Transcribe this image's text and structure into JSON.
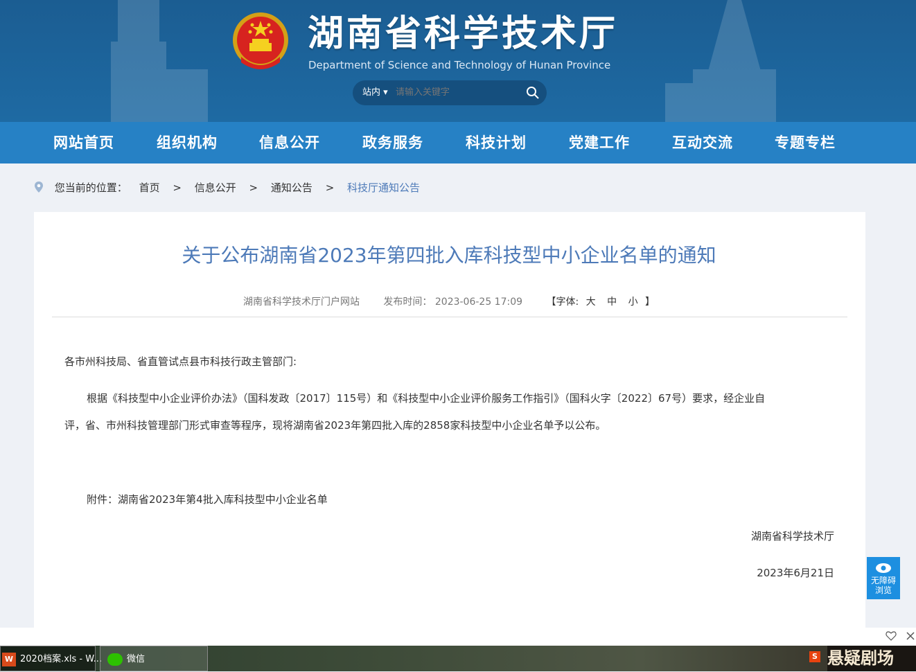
{
  "header": {
    "title": "湖南省科学技术厅",
    "subtitle": "Department of Science and Technology of Hunan Province",
    "search": {
      "scope": "站内",
      "placeholder": "请输入关键字"
    }
  },
  "nav": [
    "网站首页",
    "组织机构",
    "信息公开",
    "政务服务",
    "科技计划",
    "党建工作",
    "互动交流",
    "专题专栏"
  ],
  "breadcrumb": {
    "prefix": "您当前的位置：",
    "items": [
      "首页",
      "信息公开",
      "通知公告",
      "科技厅通知公告"
    ],
    "separator": ">"
  },
  "article": {
    "title": "关于公布湖南省2023年第四批入库科技型中小企业名单的通知",
    "source": "湖南省科学技术厅门户网站",
    "publish_label": "发布时间：",
    "publish_time": "2023-06-25 17:09",
    "font_label": "【字体:",
    "font_sizes": [
      "大",
      "中",
      "小"
    ],
    "font_end": "】",
    "salutation": "各市州科技局、省直管试点县市科技行政主管部门:",
    "body_line1": "根据《科技型中小企业评价办法》（国科发政〔2017〕115号）和《科技型中小企业评价服务工作指引》（国科火字〔2022〕67号）要求，经企业自",
    "body_line2": "评，省、市州科技管理部门形式审查等程序，现将湖南省2023年第四批入库的2858家科技型中小企业名单予以公布。",
    "attachment": "附件：湖南省2023年第4批入库科技型中小企业名单",
    "signature": "湖南省科学技术厅",
    "date": "2023年6月21日"
  },
  "accessibility": {
    "line1": "无障碍",
    "line2": "浏览"
  },
  "taskbar": {
    "items": [
      "2020档案.xls - W...",
      "微信"
    ],
    "right_text": "悬疑剧场"
  },
  "colors": {
    "nav": "#2681c5",
    "header": "#1e6aa3",
    "title": "#4d7ab8"
  }
}
